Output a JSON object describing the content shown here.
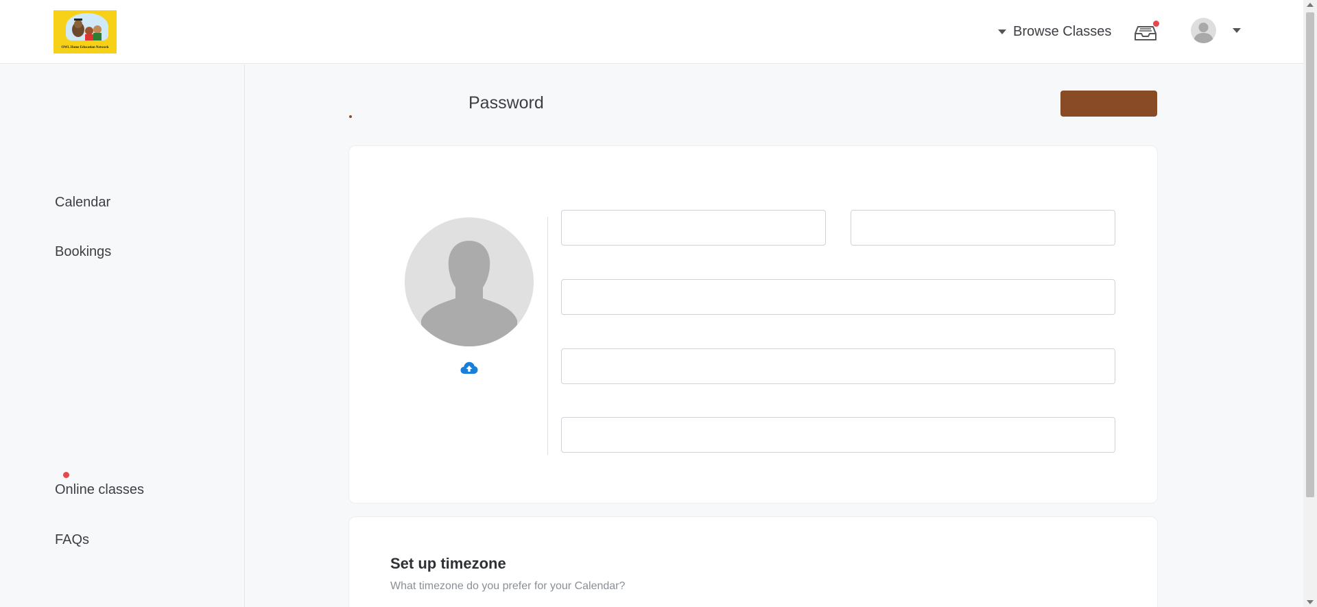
{
  "header": {
    "logo_text": "OWL Home Education Network",
    "browse_label": "Browse Classes",
    "inbox_icon": "inbox-icon",
    "avatar_icon": "user-avatar-icon"
  },
  "sidebar": {
    "items": [
      {
        "label": "Calendar"
      },
      {
        "label": "Bookings"
      },
      {
        "label": "Online classes"
      },
      {
        "label": "FAQs"
      }
    ]
  },
  "main": {
    "title": "Password",
    "profile": {
      "upload_icon": "cloud-upload-icon",
      "fields": [
        {
          "value": "",
          "placeholder": ""
        },
        {
          "value": "",
          "placeholder": ""
        },
        {
          "value": "",
          "placeholder": ""
        },
        {
          "value": "",
          "placeholder": ""
        },
        {
          "value": "",
          "placeholder": ""
        }
      ]
    },
    "timezone": {
      "title": "Set up timezone",
      "subtitle": "What timezone do you prefer for your Calendar?"
    }
  },
  "colors": {
    "accent": "#894b25",
    "notification": "#e5484d",
    "logo_bg": "#f7d117",
    "upload": "#1a7fd9"
  }
}
